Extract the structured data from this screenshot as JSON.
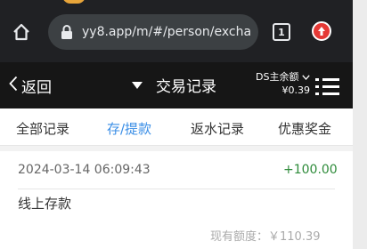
{
  "browser": {
    "url": "yy8.app/m/#/person/excha",
    "tab_count": "1"
  },
  "header": {
    "back_label": "返回",
    "title": "交易记录",
    "balance_label": "DS主余额",
    "balance_value": "¥0.39"
  },
  "tabs": [
    {
      "label": "全部记录",
      "active": false
    },
    {
      "label": "存/提款",
      "active": true
    },
    {
      "label": "返水记录",
      "active": false
    },
    {
      "label": "优惠奖金",
      "active": false
    }
  ],
  "record": {
    "datetime": "2024-03-14 06:09:43",
    "amount": "+100.00",
    "description": "线上存款",
    "quota": "现有额度：￥110.39"
  },
  "icons": [
    "home-icon",
    "lock-icon",
    "tab-switcher-icon",
    "download-icon",
    "chevron-left-icon",
    "dropdown-triangle-icon",
    "chevron-down-icon",
    "menu-icon"
  ],
  "colors": {
    "active_tab": "#3a8ee6",
    "amount_positive": "#2e8b3a",
    "appbar_bg": "#161616",
    "chrome_bg": "#202124"
  }
}
